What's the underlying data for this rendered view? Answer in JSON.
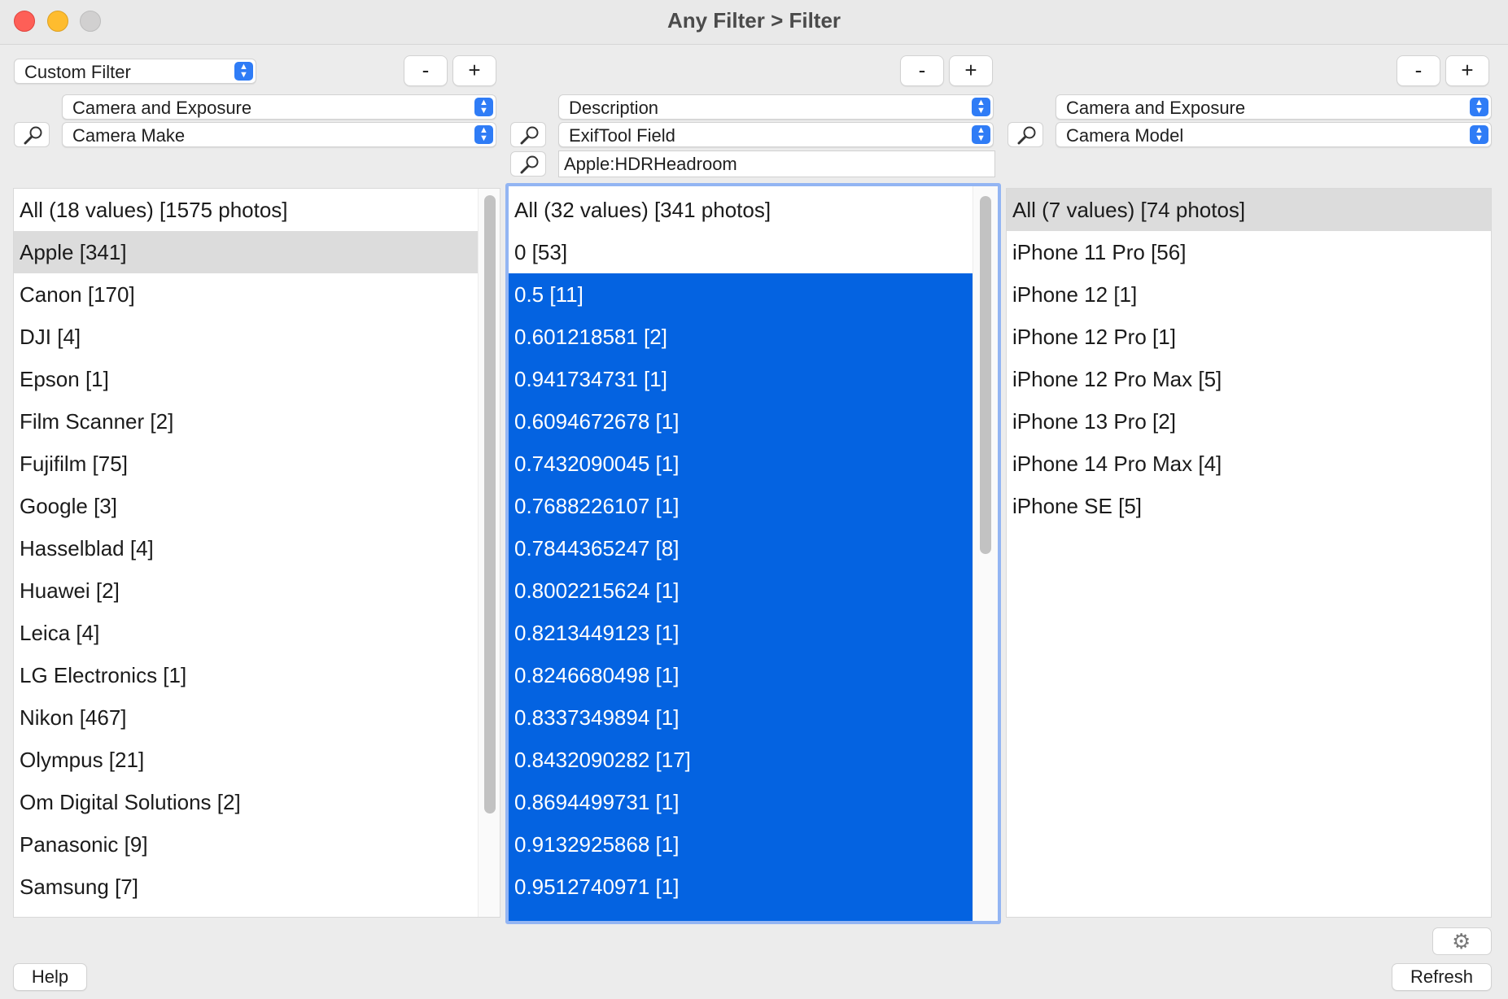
{
  "window": {
    "title": "Any Filter > Filter"
  },
  "toolbar": {
    "filter_type": "Custom Filter",
    "minus_label": "-",
    "plus_label": "+"
  },
  "columns": [
    {
      "category": "Camera and Exposure",
      "field": "Camera Make",
      "items": [
        "All (18 values) [1575 photos]",
        "Apple [341]",
        "Canon [170]",
        "DJI [4]",
        "Epson [1]",
        "Film Scanner [2]",
        "Fujifilm [75]",
        "Google [3]",
        "Hasselblad [4]",
        "Huawei [2]",
        "Leica [4]",
        "LG Electronics [1]",
        "Nikon [467]",
        "Olympus [21]",
        "Om Digital Solutions [2]",
        "Panasonic [9]",
        "Samsung [7]"
      ]
    },
    {
      "category": "Description",
      "field": "ExifTool Field",
      "field_value": "Apple:HDRHeadroom",
      "items": [
        "All (32 values) [341 photos]",
        "0 [53]",
        "0.5 [11]",
        "0.601218581 [2]",
        "0.941734731 [1]",
        "0.6094672678 [1]",
        "0.7432090045 [1]",
        "0.7688226107 [1]",
        "0.7844365247 [8]",
        "0.8002215624 [1]",
        "0.8213449123 [1]",
        "0.8246680498 [1]",
        "0.8337349894 [1]",
        "0.8432090282 [17]",
        "0.8694499731 [1]",
        "0.9132925868 [1]",
        "0.9512740971 [1]"
      ]
    },
    {
      "category": "Camera and Exposure",
      "field": "Camera Model",
      "items": [
        "All (7 values) [74 photos]",
        "iPhone 11 Pro [56]",
        "iPhone 12 [1]",
        "iPhone 12 Pro [1]",
        "iPhone 12 Pro Max [5]",
        "iPhone 13 Pro [2]",
        "iPhone 14 Pro Max [4]",
        "iPhone SE [5]"
      ]
    }
  ],
  "footer": {
    "help_label": "Help",
    "refresh_label": "Refresh"
  },
  "icons": {
    "search": "search-icon",
    "gear": "gear-icon"
  },
  "colors": {
    "selection": "#0463e1",
    "focus_ring": "#93b5f3",
    "popup_arrow": "#2f7cf6"
  }
}
